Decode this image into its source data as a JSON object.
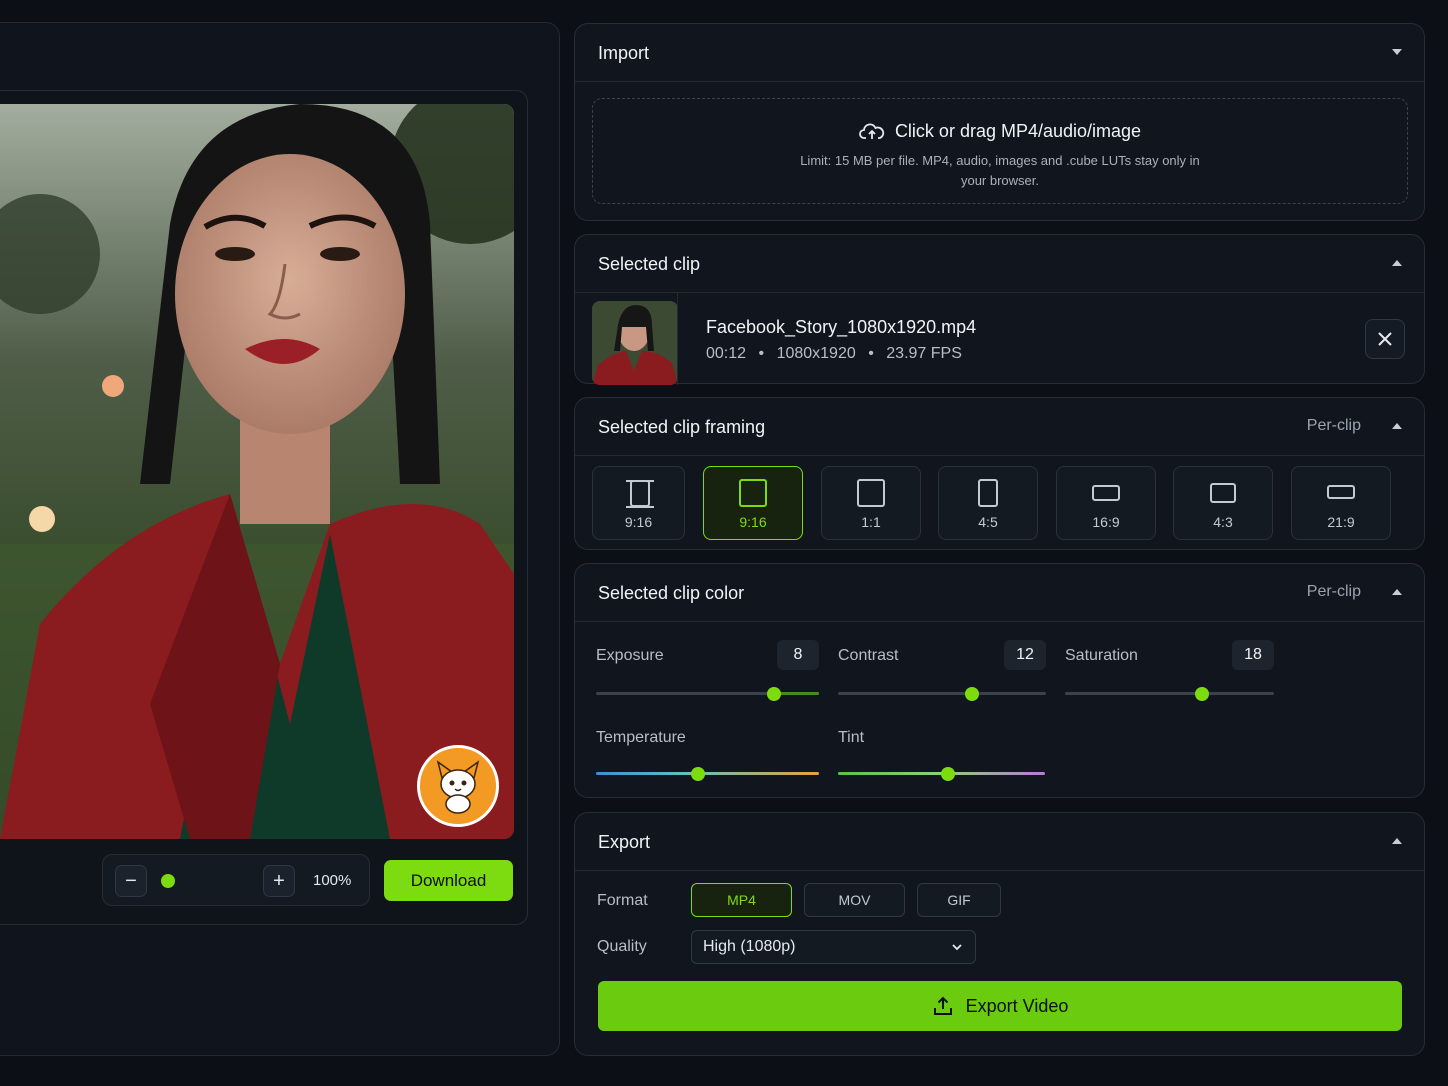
{
  "preview": {
    "zoom_minus": "−",
    "zoom_plus": "+",
    "zoom_level": "100%",
    "zoom_position": 0.05,
    "download_label": "Download"
  },
  "import": {
    "title": "Import",
    "drop_title": "Click or drag MP4/audio/image",
    "drop_subtitle": "Limit: 15 MB per file. MP4, audio, images and .cube LUTs stay only in your browser."
  },
  "selected_clip": {
    "title": "Selected clip",
    "file_name": "Facebook_Story_1080x1920.mp4",
    "duration": "00:12",
    "resolution": "1080x1920",
    "fps": "23.97 FPS",
    "separator": "•"
  },
  "framing": {
    "title": "Selected clip framing",
    "scope": "Per-clip",
    "options": [
      {
        "label": "9:16",
        "icon": "fit-frame-icon"
      },
      {
        "label": "9:16",
        "icon": "portrait-icon",
        "active": true
      },
      {
        "label": "1:1",
        "icon": "square-icon"
      },
      {
        "label": "4:5",
        "icon": "portrait-narrow-icon"
      },
      {
        "label": "16:9",
        "icon": "landscape-icon"
      },
      {
        "label": "4:3",
        "icon": "landscape-standard-icon"
      },
      {
        "label": "21:9",
        "icon": "ultrawide-icon"
      }
    ]
  },
  "color": {
    "title": "Selected clip color",
    "scope": "Per-clip",
    "exposure": {
      "label": "Exposure",
      "value": "8"
    },
    "contrast": {
      "label": "Contrast",
      "value": "12"
    },
    "saturation": {
      "label": "Saturation",
      "value": "18"
    },
    "temperature": {
      "label": "Temperature"
    },
    "tint": {
      "label": "Tint"
    }
  },
  "export": {
    "title": "Export",
    "format_label": "Format",
    "formats": [
      "MP4",
      "MOV",
      "GIF"
    ],
    "selected_format": "MP4",
    "quality_label": "Quality",
    "quality_value": "High (1080p)",
    "export_label": "Export Video"
  },
  "colors": {
    "accent": "#7ddc10",
    "background": "#0c1016",
    "panel": "#11161e"
  }
}
